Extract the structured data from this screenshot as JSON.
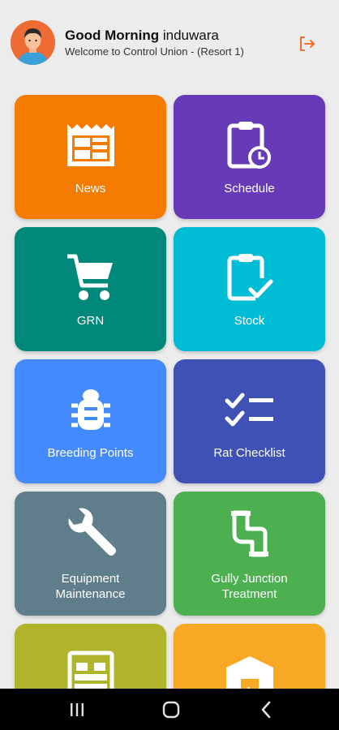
{
  "header": {
    "greeting_bold": "Good Morning",
    "user_name": "induwara",
    "subtitle": "Welcome to Control Union - (Resort 1)",
    "logout_icon": "logout-icon",
    "accent_color": "#f26f2a"
  },
  "tiles": [
    {
      "label": "News",
      "icon": "newspaper-icon",
      "color": "#f57c00"
    },
    {
      "label": "Schedule",
      "icon": "clipboard-clock-icon",
      "color": "#673ab7"
    },
    {
      "label": "GRN",
      "icon": "cart-icon",
      "color": "#00897b"
    },
    {
      "label": "Stock",
      "icon": "clipboard-check-icon",
      "color": "#00bcd4"
    },
    {
      "label": "Breeding Points",
      "icon": "bug-icon",
      "color": "#448aff"
    },
    {
      "label": "Rat Checklist",
      "icon": "checklist-icon",
      "color": "#3f51b5"
    },
    {
      "label": "Equipment\nMaintenance",
      "icon": "wrench-icon",
      "color": "#607d8b"
    },
    {
      "label": "Gully Junction\nTreatment",
      "icon": "pipe-icon",
      "color": "#4caf50"
    },
    {
      "label": "",
      "icon": "bed-icon",
      "color": "#afb42b"
    },
    {
      "label": "",
      "icon": "warehouse-icon",
      "color": "#f9a825"
    }
  ],
  "navbar": {
    "recents_icon": "recents-icon",
    "home_icon": "home-icon",
    "back_icon": "back-icon"
  }
}
